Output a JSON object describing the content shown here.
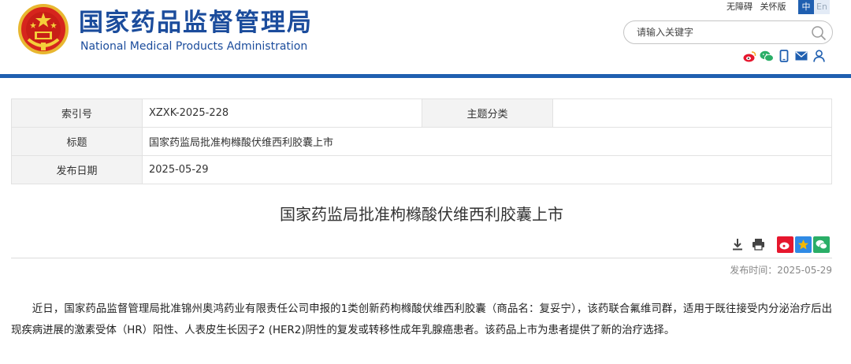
{
  "header": {
    "title_cn": "国家药品监督管理局",
    "title_en": "National Medical Products Administration",
    "links": [
      "无障碍",
      "关怀版"
    ],
    "lang": {
      "zh": "中",
      "en": "En"
    }
  },
  "search": {
    "placeholder": "请输入关键字"
  },
  "info_table": {
    "index_label": "索引号",
    "index_value": "XZXK-2025-228",
    "category_label": "主题分类",
    "category_value": "",
    "title_label": "标题",
    "title_value": "国家药监局批准枸橼酸伏维西利胶囊上市",
    "date_label": "发布日期",
    "date_value": "2025-05-29"
  },
  "article": {
    "title": "国家药监局批准枸橼酸伏维西利胶囊上市",
    "publish_time": "发布时间：2025-05-29",
    "body": "近日，国家药品监督管理局批准锦州奥鸿药业有限责任公司申报的1类创新药枸橼酸伏维西利胶囊（商品名：复妥宁），该药联合氟维司群，适用于既往接受内分泌治疗后出现疾病进展的激素受体（HR）阳性、人表皮生长因子2 (HER2)阴性的复发或转移性成年乳腺癌患者。该药品上市为患者提供了新的治疗选择。"
  },
  "colors": {
    "brand_blue": "#1b4c9c",
    "header_line": "#1f5fb0",
    "weibo_red": "#e6162d",
    "wechat_green": "#2aae67",
    "star_gold": "#f5b800"
  },
  "icons": {
    "emblem": "national-emblem",
    "search": "search-icon",
    "weibo": "weibo-icon",
    "wechat": "wechat-icon",
    "mobile": "mobile-icon",
    "mail": "mail-icon",
    "user": "user-icon",
    "download": "download-icon",
    "print": "print-icon",
    "share_weibo": "share-weibo-icon",
    "share_qzone": "share-qzone-icon",
    "share_wechat": "share-wechat-icon"
  }
}
